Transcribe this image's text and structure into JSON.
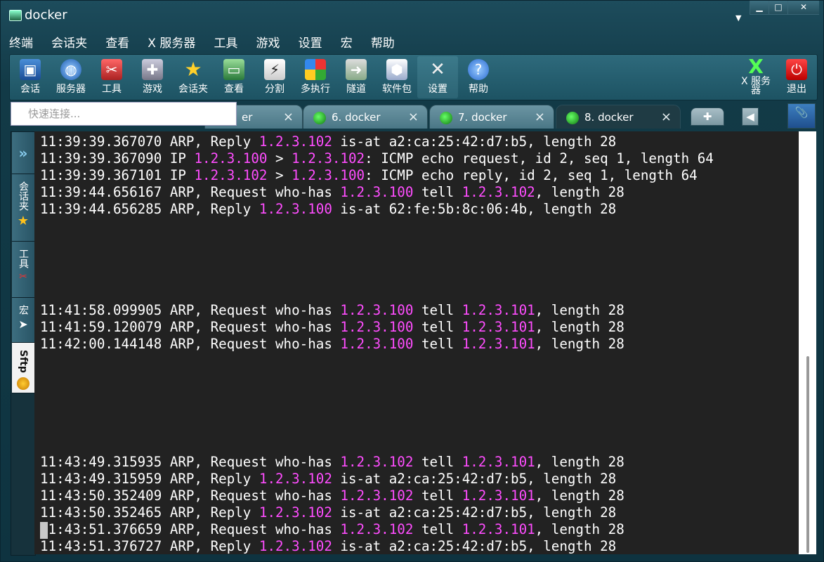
{
  "window": {
    "title": "docker",
    "minimize": "▁",
    "maximize": "□",
    "close": "✕",
    "dropdown": "▼"
  },
  "menu": [
    "终端",
    "会话夹",
    "查看",
    "X 服务器",
    "工具",
    "游戏",
    "设置",
    "宏",
    "帮助"
  ],
  "toolbar": {
    "items": [
      {
        "label": "会话",
        "icon": "session-icon"
      },
      {
        "label": "服务器",
        "icon": "server-icon"
      },
      {
        "label": "工具",
        "icon": "tools-icon"
      },
      {
        "label": "游戏",
        "icon": "gamepad-icon"
      },
      {
        "label": "会话夹",
        "icon": "star-icon"
      },
      {
        "label": "查看",
        "icon": "monitor-icon"
      },
      {
        "label": "分割",
        "icon": "split-icon"
      },
      {
        "label": "多执行",
        "icon": "multi-exec-icon"
      },
      {
        "label": "隧道",
        "icon": "tunnel-icon"
      },
      {
        "label": "软件包",
        "icon": "packages-icon"
      },
      {
        "label": "设置",
        "icon": "settings-icon"
      },
      {
        "label": "帮助",
        "icon": "help-icon"
      }
    ],
    "xserver_label": "X 服务\n器",
    "exit_label": "退出"
  },
  "quick_connect": {
    "placeholder": "快速连接..."
  },
  "tabs": [
    {
      "label": "er",
      "active": false
    },
    {
      "label": "6. docker",
      "active": false
    },
    {
      "label": "7. docker",
      "active": false
    },
    {
      "label": "8. docker",
      "active": true
    }
  ],
  "sidebar": [
    {
      "label": "",
      "icon": "expand-icon"
    },
    {
      "label": "会话夹",
      "icon": "star-icon"
    },
    {
      "label": "工具",
      "icon": "tools-icon"
    },
    {
      "label": "宏",
      "icon": "macro-icon"
    },
    {
      "label": "Sftp",
      "icon": "sftp-icon"
    }
  ],
  "terminal": {
    "lines": [
      [
        {
          "t": "11:39:39.367070 ARP, Reply "
        },
        {
          "t": "1.2.3.102",
          "ip": true
        },
        {
          "t": " is-at a2:ca:25:42:d7:b5, length 28"
        }
      ],
      [
        {
          "t": "11:39:39.367090 IP "
        },
        {
          "t": "1.2.3.100",
          "ip": true
        },
        {
          "t": " > "
        },
        {
          "t": "1.2.3.102",
          "ip": true
        },
        {
          "t": ": ICMP echo request, id 2, seq 1, length 64"
        }
      ],
      [
        {
          "t": "11:39:39.367101 IP "
        },
        {
          "t": "1.2.3.102",
          "ip": true
        },
        {
          "t": " > "
        },
        {
          "t": "1.2.3.100",
          "ip": true
        },
        {
          "t": ": ICMP echo reply, id 2, seq 1, length 64"
        }
      ],
      [
        {
          "t": "11:39:44.656167 ARP, Request who-has "
        },
        {
          "t": "1.2.3.100",
          "ip": true
        },
        {
          "t": " tell "
        },
        {
          "t": "1.2.3.102",
          "ip": true
        },
        {
          "t": ", length 28"
        }
      ],
      [
        {
          "t": "11:39:44.656285 ARP, Reply "
        },
        {
          "t": "1.2.3.100",
          "ip": true
        },
        {
          "t": " is-at 62:fe:5b:8c:06:4b, length 28"
        }
      ],
      [],
      [],
      [],
      [],
      [],
      [
        {
          "t": "11:41:58.099905 ARP, Request who-has "
        },
        {
          "t": "1.2.3.100",
          "ip": true
        },
        {
          "t": " tell "
        },
        {
          "t": "1.2.3.101",
          "ip": true
        },
        {
          "t": ", length 28"
        }
      ],
      [
        {
          "t": "11:41:59.120079 ARP, Request who-has "
        },
        {
          "t": "1.2.3.100",
          "ip": true
        },
        {
          "t": " tell "
        },
        {
          "t": "1.2.3.101",
          "ip": true
        },
        {
          "t": ", length 28"
        }
      ],
      [
        {
          "t": "11:42:00.144148 ARP, Request who-has "
        },
        {
          "t": "1.2.3.100",
          "ip": true
        },
        {
          "t": " tell "
        },
        {
          "t": "1.2.3.101",
          "ip": true
        },
        {
          "t": ", length 28"
        }
      ],
      [],
      [],
      [],
      [],
      [],
      [],
      [
        {
          "t": "11:43:49.315935 ARP, Request who-has "
        },
        {
          "t": "1.2.3.102",
          "ip": true
        },
        {
          "t": " tell "
        },
        {
          "t": "1.2.3.101",
          "ip": true
        },
        {
          "t": ", length 28"
        }
      ],
      [
        {
          "t": "11:43:49.315959 ARP, Reply "
        },
        {
          "t": "1.2.3.102",
          "ip": true
        },
        {
          "t": " is-at a2:ca:25:42:d7:b5, length 28"
        }
      ],
      [
        {
          "t": "11:43:50.352409 ARP, Request who-has "
        },
        {
          "t": "1.2.3.102",
          "ip": true
        },
        {
          "t": " tell "
        },
        {
          "t": "1.2.3.101",
          "ip": true
        },
        {
          "t": ", length 28"
        }
      ],
      [
        {
          "t": "11:43:50.352465 ARP, Reply "
        },
        {
          "t": "1.2.3.102",
          "ip": true
        },
        {
          "t": " is-at a2:ca:25:42:d7:b5, length 28"
        }
      ],
      [
        {
          "t": "11:43:51.376659 ARP, Request who-has "
        },
        {
          "t": "1.2.3.102",
          "ip": true
        },
        {
          "t": " tell "
        },
        {
          "t": "1.2.3.101",
          "ip": true
        },
        {
          "t": ", length 28"
        }
      ],
      [
        {
          "t": "11:43:51.376727 ARP, Reply "
        },
        {
          "t": "1.2.3.102",
          "ip": true
        },
        {
          "t": " is-at a2:ca:25:42:d7:b5, length 28"
        }
      ]
    ]
  },
  "colors": {
    "terminal_bg": "#222222",
    "terminal_fg": "#ffffff",
    "ip_highlight": "#ff4dff"
  }
}
